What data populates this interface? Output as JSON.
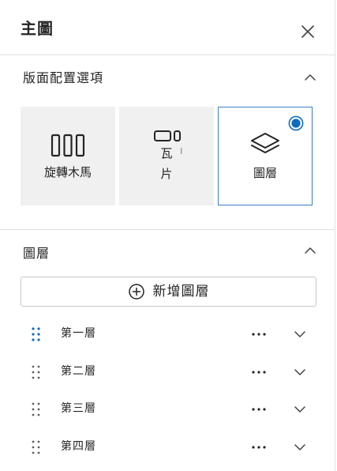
{
  "header": {
    "title": "主圖",
    "close_icon": "close-icon"
  },
  "layout_options": {
    "title": "版面配置選項",
    "options": [
      {
        "label": "旋轉木馬",
        "icon": "carousel-icon",
        "selected": false
      },
      {
        "label": "瓦片",
        "icon": "tiles-icon",
        "selected": false
      },
      {
        "label": "圖層",
        "icon": "layers-icon",
        "selected": true
      }
    ]
  },
  "layers": {
    "title": "圖層",
    "add_button_label": "新增圖層",
    "items": [
      {
        "label": "第一層",
        "active": true
      },
      {
        "label": "第二層",
        "active": false
      },
      {
        "label": "第三層",
        "active": false
      },
      {
        "label": "第四層",
        "active": false
      }
    ]
  },
  "colors": {
    "accent": "#0f6cbd",
    "selected_border": "#3b7dc4",
    "card_bg": "#f0f0f0",
    "divider": "#e1e1e1",
    "text": "#242424",
    "handle_inactive": "#616161"
  }
}
